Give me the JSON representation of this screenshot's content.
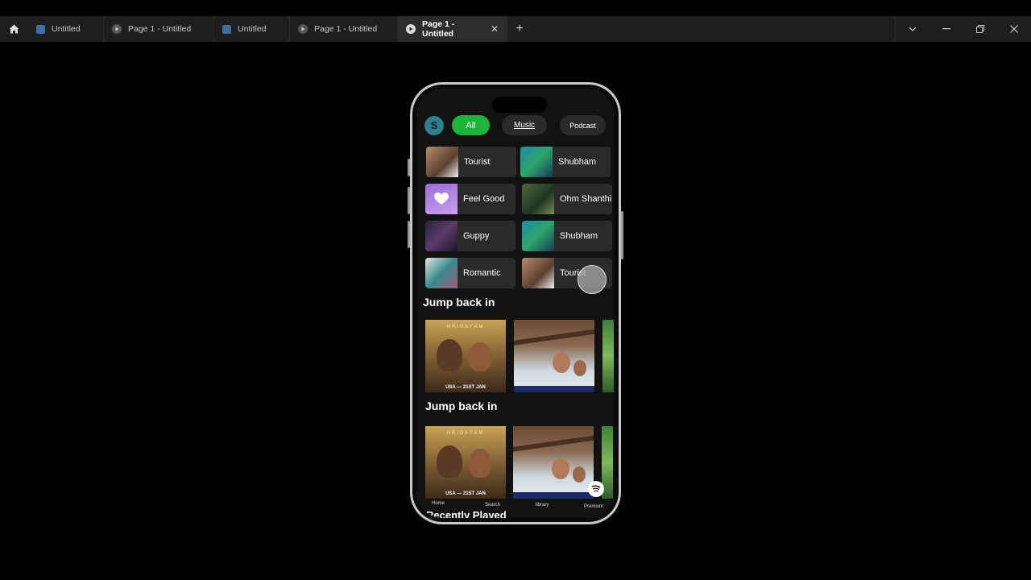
{
  "window": {
    "tabs": [
      {
        "label": "Untitled",
        "kind": "design-file",
        "active": false
      },
      {
        "label": "Page 1 - Untitled",
        "kind": "prototype",
        "active": false
      },
      {
        "label": "Untitled",
        "kind": "design-file",
        "active": false
      },
      {
        "label": "Page 1 - Untitled",
        "kind": "prototype",
        "active": false
      },
      {
        "label": "Page 1 - Untitled",
        "kind": "prototype",
        "active": true
      }
    ],
    "close_glyph": "✕",
    "new_tab_glyph": "+",
    "controls": {
      "dropdown": "⌄",
      "minimize": "—",
      "restore": "❐",
      "close": "✕"
    }
  },
  "app": {
    "avatar_letter": "S",
    "filters": {
      "all": "All",
      "music": "Music",
      "podcast": "Podcast"
    },
    "grid": [
      {
        "label": "Tourist",
        "icon": "album-art-tourist"
      },
      {
        "label": "Shubham",
        "icon": "album-art-shubham"
      },
      {
        "label": "Feel Good",
        "icon": "heart-icon"
      },
      {
        "label": "Ohm Shanthi",
        "icon": "album-art-ohm-shanthi"
      },
      {
        "label": "Guppy",
        "icon": "album-art-guppy"
      },
      {
        "label": "Shubham",
        "icon": "album-art-shubham"
      },
      {
        "label": "Romantic",
        "icon": "album-art-romantic"
      },
      {
        "label": "Tourist",
        "icon": "album-art-tourist"
      }
    ],
    "sections": {
      "jump_back_in_1": "Jump back in",
      "jump_back_in_2": "Jump back in",
      "recently_played": "Recently Played"
    },
    "posters": {
      "hridayam_title": "HRIDAYAM",
      "hridayam_footer": "USA — 21ST JAN"
    },
    "nav": {
      "home": "Home",
      "search": "Search",
      "library": "library",
      "premium": "Premium"
    },
    "colors": {
      "accent_green": "#1db43a",
      "background": "#121212",
      "card": "#2a2a2a"
    }
  }
}
